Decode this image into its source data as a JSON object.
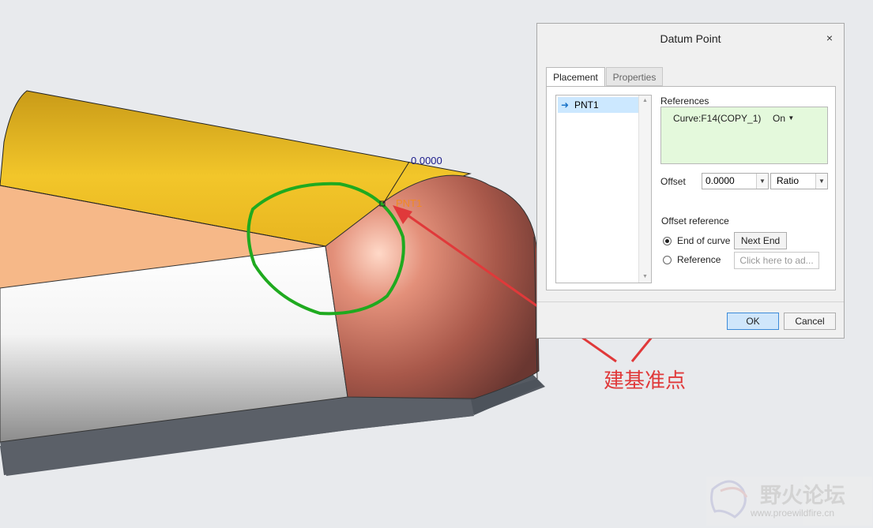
{
  "dialog": {
    "title": "Datum Point",
    "close": "×",
    "tabs": [
      {
        "label": "Placement",
        "active": true
      },
      {
        "label": "Properties",
        "active": false
      }
    ],
    "point_list": [
      {
        "label": "PNT1",
        "selected": true
      }
    ],
    "references": {
      "heading": "References",
      "items": [
        {
          "label": "Curve:F14(COPY_1)",
          "constraint": "On"
        }
      ]
    },
    "offset": {
      "label": "Offset",
      "value": "0.0000",
      "type": "Ratio"
    },
    "offset_reference": {
      "heading": "Offset reference",
      "options": [
        {
          "label": "End of curve",
          "checked": true,
          "button": "Next End"
        },
        {
          "label": "Reference",
          "checked": false,
          "placeholder": "Click here to ad..."
        }
      ]
    },
    "ok": "OK",
    "cancel": "Cancel"
  },
  "model_view": {
    "point_label": "PNT1",
    "dimension": "0.0000"
  },
  "annotation": {
    "text": "建基准点",
    "color": "#e0393a"
  },
  "watermark": {
    "title": "野火论坛",
    "url": "www.proewildfire.cn"
  },
  "colors": {
    "highlight_circle": "#1faa1f",
    "point_label": "#f08a24",
    "references_bg": "#e4f9dc",
    "selection": "#cce8ff"
  }
}
